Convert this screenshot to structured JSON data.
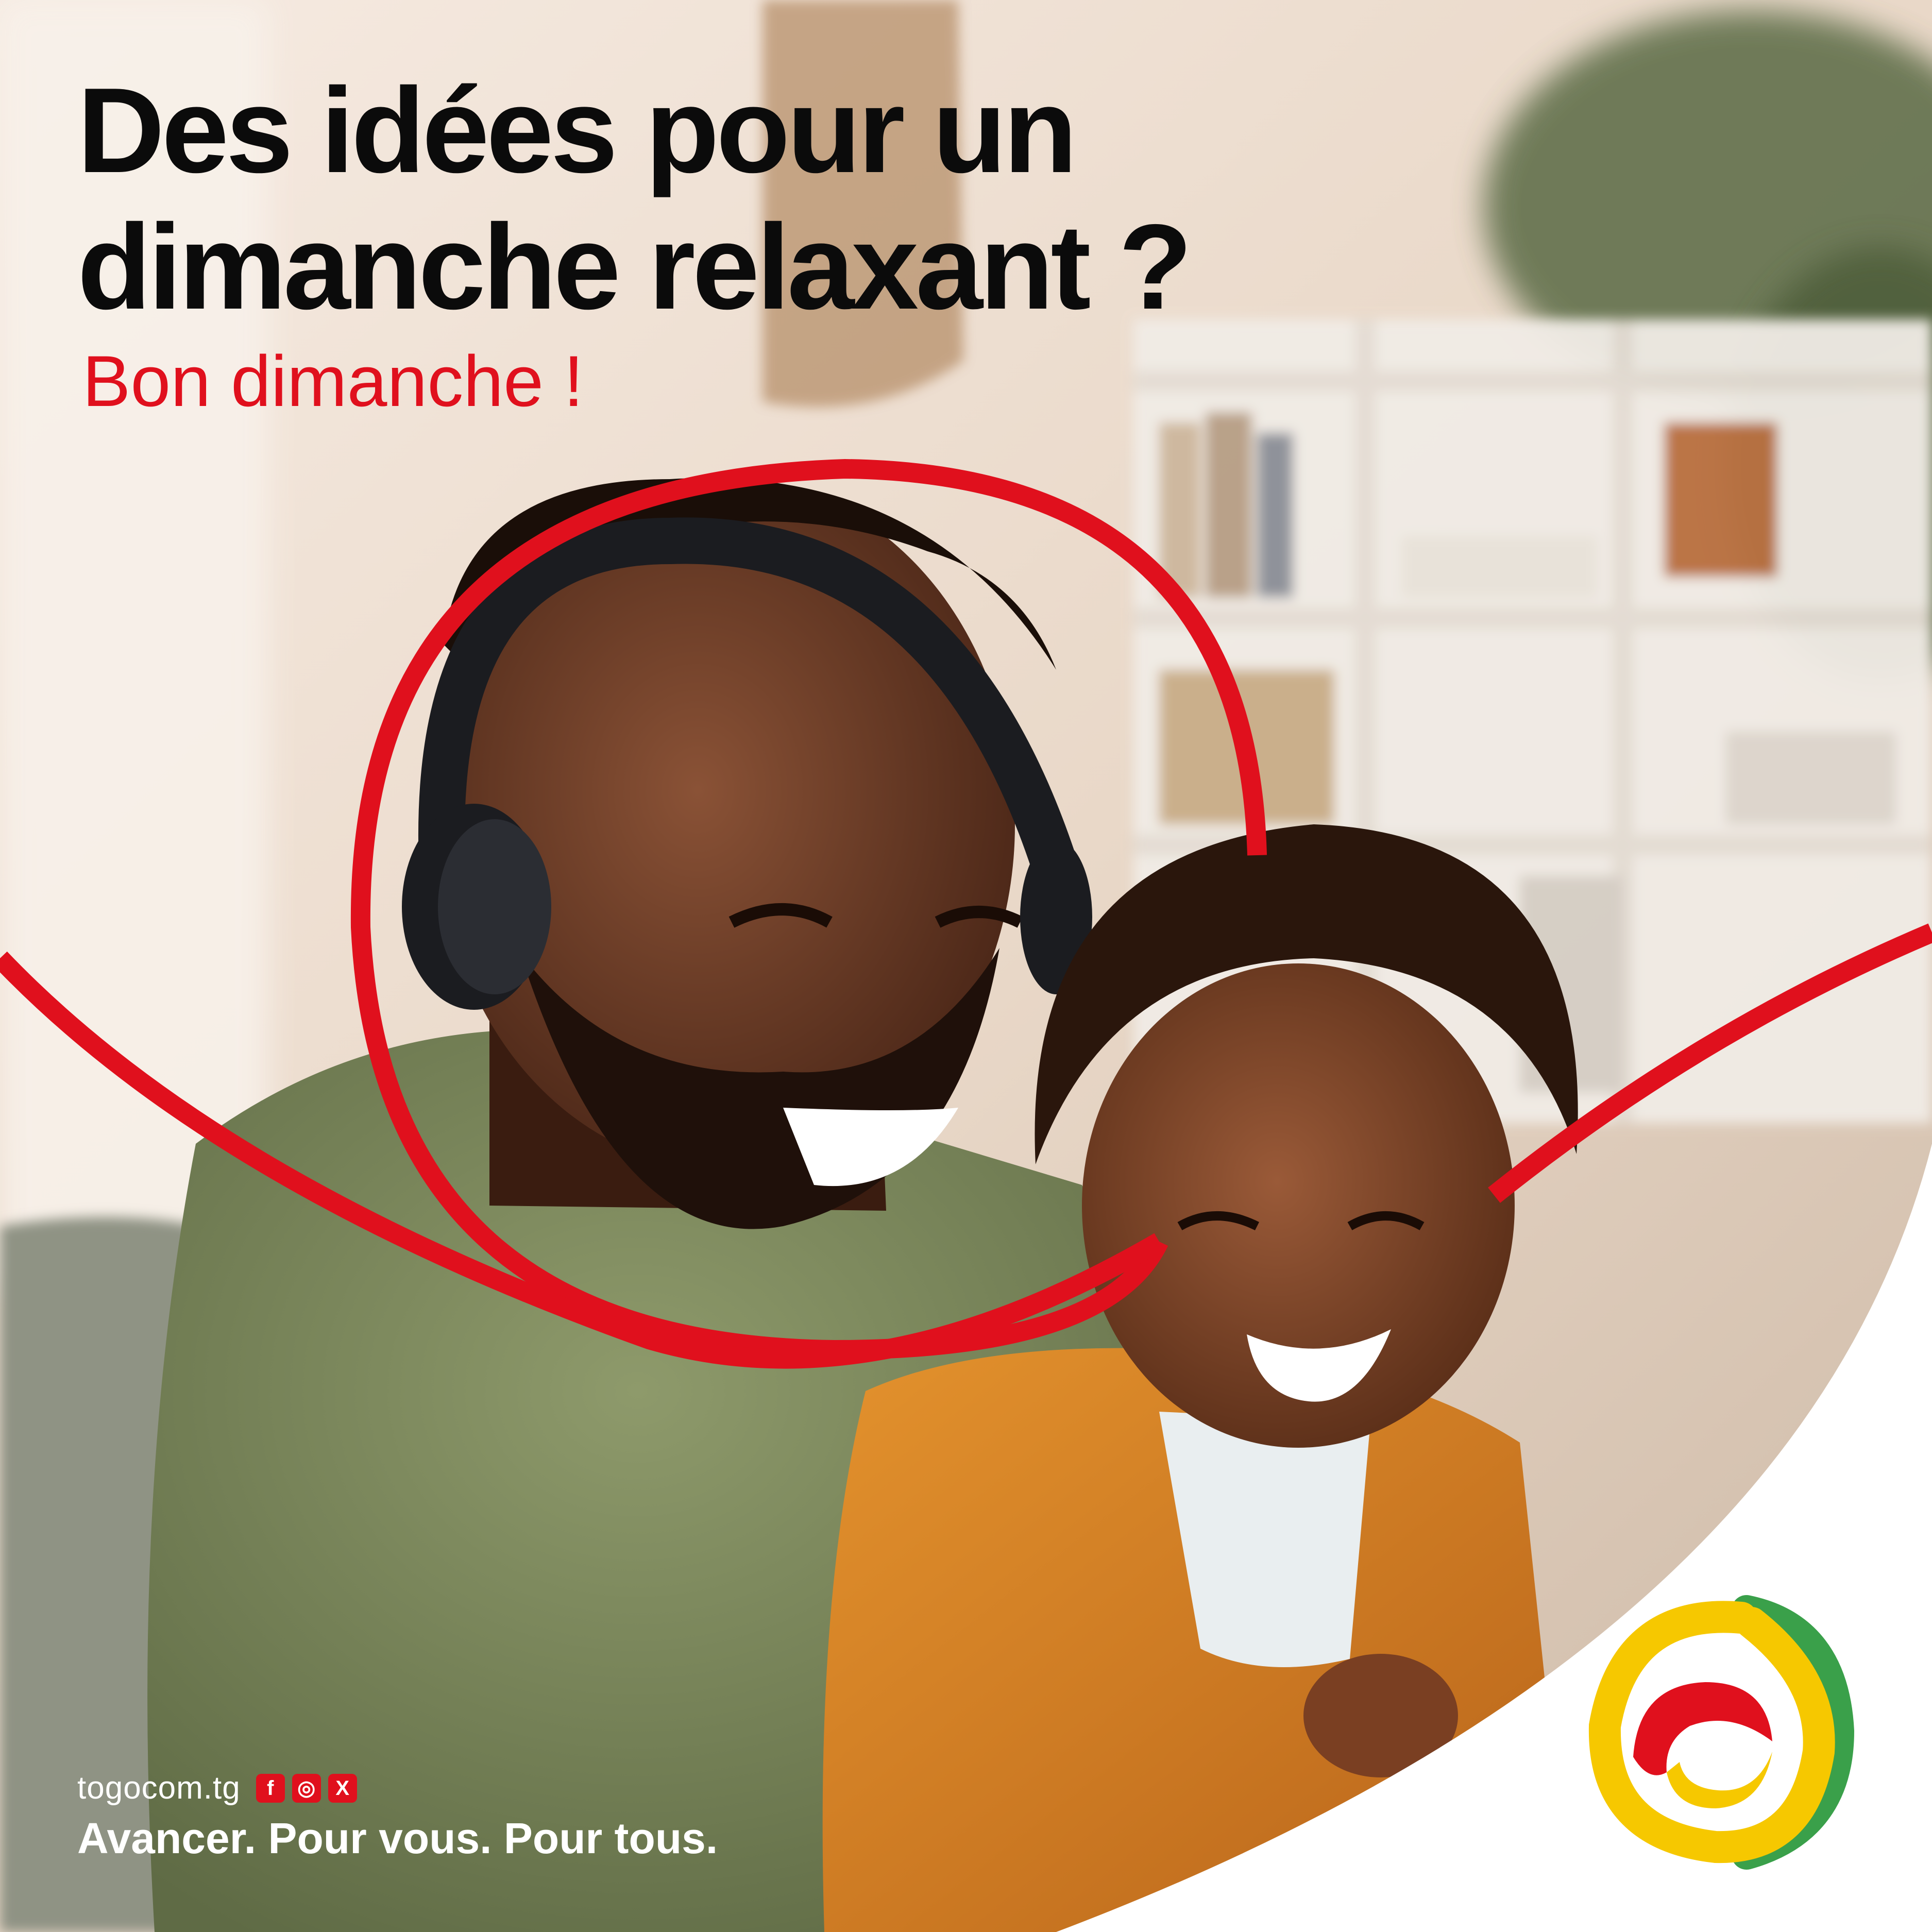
{
  "headline": {
    "line1": "Des idées pour un",
    "line2": "dimanche relaxant ?"
  },
  "subhead": "Bon dimanche !",
  "footer": {
    "website": "togocom.tg",
    "social_icons": [
      {
        "icon": "facebook-icon",
        "glyph": "f"
      },
      {
        "icon": "instagram-icon",
        "glyph": "◎"
      },
      {
        "icon": "x-icon",
        "glyph": "X"
      }
    ],
    "tagline": "Avancer. Pour vous. Pour tous."
  },
  "brand": {
    "logo_icon": "togocom-logo-icon",
    "colors": {
      "red": "#e0101d",
      "yellow": "#f6c800",
      "green": "#3aa04a",
      "white": "#ffffff",
      "text_dark": "#0b0b0b"
    }
  }
}
